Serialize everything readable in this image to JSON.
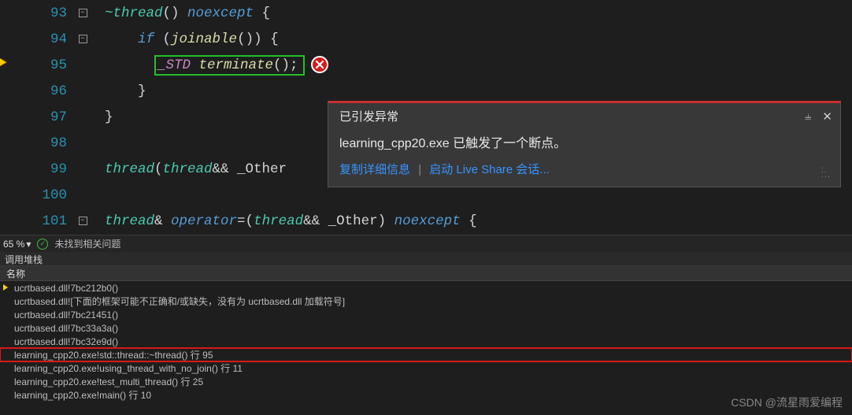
{
  "editor": {
    "lines": [
      {
        "num": 93,
        "fold": "-",
        "tokens": [
          [
            "type",
            "~thread"
          ],
          [
            "punc",
            "() "
          ],
          [
            "kw",
            "noexcept"
          ],
          [
            "punc",
            " {"
          ]
        ]
      },
      {
        "num": 94,
        "fold": "-",
        "tokens": [
          [
            "punc",
            "    "
          ],
          [
            "kw",
            "if"
          ],
          [
            "punc",
            " ("
          ],
          [
            "func",
            "joinable"
          ],
          [
            "punc",
            "()) {"
          ]
        ]
      },
      {
        "num": 95,
        "fold": "",
        "highlight": true,
        "tokens": [
          [
            "punc",
            "        "
          ],
          [
            "macro",
            "_STD "
          ],
          [
            "func",
            "terminate"
          ],
          [
            "punc",
            "();"
          ]
        ]
      },
      {
        "num": 96,
        "fold": "",
        "tokens": [
          [
            "punc",
            "    }"
          ]
        ]
      },
      {
        "num": 97,
        "fold": "",
        "tokens": [
          [
            "punc",
            "}"
          ]
        ]
      },
      {
        "num": 98,
        "fold": "",
        "tokens": []
      },
      {
        "num": 99,
        "fold": "",
        "tokens": [
          [
            "type",
            "thread"
          ],
          [
            "punc",
            "("
          ],
          [
            "type",
            "thread"
          ],
          [
            "punc",
            "&& _Other"
          ]
        ]
      },
      {
        "num": 100,
        "fold": "",
        "tokens": []
      },
      {
        "num": 101,
        "fold": "-",
        "tokens": [
          [
            "type",
            "thread"
          ],
          [
            "punc",
            "& "
          ],
          [
            "kw",
            "operator"
          ],
          [
            "punc",
            "=("
          ],
          [
            "type",
            "thread"
          ],
          [
            "punc",
            "&& _Other) "
          ],
          [
            "kw",
            "noexcept"
          ],
          [
            "punc",
            " {"
          ]
        ]
      }
    ]
  },
  "exception_tooltip": {
    "title": "已引发异常",
    "message": "learning_cpp20.exe 已触发了一个断点。",
    "link_copy": "复制详细信息",
    "link_liveshare": "启动 Live Share 会话..."
  },
  "statusbar": {
    "zoom": "65 %",
    "no_issues": "未找到相关问题"
  },
  "callstack": {
    "panel_title": "调用堆栈",
    "col_name": "名称",
    "frames": [
      {
        "text": "ucrtbased.dll!7bc212b0()",
        "current": true
      },
      {
        "text": "ucrtbased.dll![下面的框架可能不正确和/或缺失，没有为 ucrtbased.dll 加载符号]"
      },
      {
        "text": "ucrtbased.dll!7bc21451()"
      },
      {
        "text": "ucrtbased.dll!7bc33a3a()"
      },
      {
        "text": "ucrtbased.dll!7bc32e9d()"
      },
      {
        "text": "learning_cpp20.exe!std::thread::~thread() 行 95",
        "boxed": true
      },
      {
        "text": "learning_cpp20.exe!using_thread_with_no_join() 行 11"
      },
      {
        "text": "learning_cpp20.exe!test_multi_thread() 行 25"
      },
      {
        "text": "learning_cpp20.exe!main() 行 10"
      }
    ]
  },
  "watermark": "CSDN @流星雨爱编程"
}
